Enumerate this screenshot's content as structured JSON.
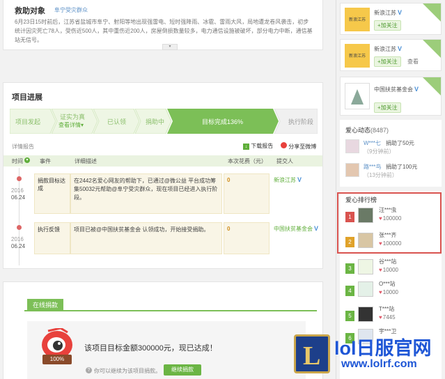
{
  "rescue": {
    "title": "救助对象",
    "subtitle": "阜宁受灾群众",
    "body": "6月23日15时前后，江苏省盐城市阜宁、射阳等地出现强雷电、短时强降雨、冰雹、雷雨大风，局地遭龙卷风袭击，初步统计因灾死亡78人，受伤近500人，其中重伤近200人，房屋倒损数量较多，电力通信设施被破坏，部分电力中断，通信基站无信号。"
  },
  "progress": {
    "title": "项目进展",
    "steps": [
      {
        "label": "项目发起"
      },
      {
        "label": "证实为真",
        "sub": "查看详情▾"
      },
      {
        "label": "已认领"
      },
      {
        "label": "捐助中"
      },
      {
        "label": "目标完成136%"
      },
      {
        "label": "执行阶段"
      }
    ],
    "report_label": "详情报告",
    "download_label": "下载报告",
    "share_label": "分享至微博",
    "columns": [
      "时间",
      "事件",
      "详细描述",
      "本次花费（元）",
      "提交人"
    ],
    "rows": [
      {
        "year": "2016",
        "date": "06.24",
        "event": "捐款目标达成",
        "desc": "在2442名爱心网友的帮助下，已通过@微公益 平台成功筹集50032元帮助@阜宁受灾群众，现在项目已经进入执行阶段。",
        "cost": "0",
        "submitter": "新浪江苏"
      },
      {
        "year": "2016",
        "date": "06.24",
        "event": "执行反馈",
        "desc": "项目已被@中国扶贫基金会 认领成功，开始接受捐助。",
        "cost": "0",
        "submitter": "中国扶贫基金会"
      }
    ]
  },
  "donate": {
    "tab": "在线捐款",
    "message": "该项目目标金额300000元，现已达成！",
    "badge": "100%",
    "note": "你可以继续为该项目捐款。",
    "button": "继续捐款"
  },
  "sidebar": {
    "orgs": [
      {
        "name": "新浪江苏",
        "follow": "+加关注",
        "extra": ""
      },
      {
        "name": "新浪江苏",
        "follow": "+加关注",
        "extra": "查看"
      },
      {
        "name": "中国扶贫基金会",
        "follow": "+加关注",
        "extra": ""
      }
    ],
    "activity_title": "爱心动态",
    "activity_count": "(8487)",
    "activity": [
      {
        "user": "W***七",
        "action": "捐助了50元",
        "time": "（9分钟前）"
      },
      {
        "user": "路***鸟",
        "action": "捐助了100元",
        "time": "（13分钟前）"
      }
    ],
    "rank_title": "爱心排行榜",
    "ranks": [
      {
        "num": "1",
        "name": "汪***虫",
        "value": "100000",
        "color": "#d9534f"
      },
      {
        "num": "2",
        "name": "张***齐",
        "value": "100000",
        "color": "#e0a22a"
      },
      {
        "num": "3",
        "name": "谷***站",
        "value": "10000",
        "color": "#6bb544"
      },
      {
        "num": "4",
        "name": "O***站",
        "value": "10000",
        "color": "#6bb544"
      },
      {
        "num": "5",
        "name": "T***站",
        "value": "7445",
        "color": "#6bb544"
      },
      {
        "num": "6",
        "name": "宇***卫",
        "value": "",
        "color": "#6bb544"
      }
    ]
  },
  "watermark": {
    "title": "lol日服官网",
    "url": "www.lolrf.com"
  }
}
